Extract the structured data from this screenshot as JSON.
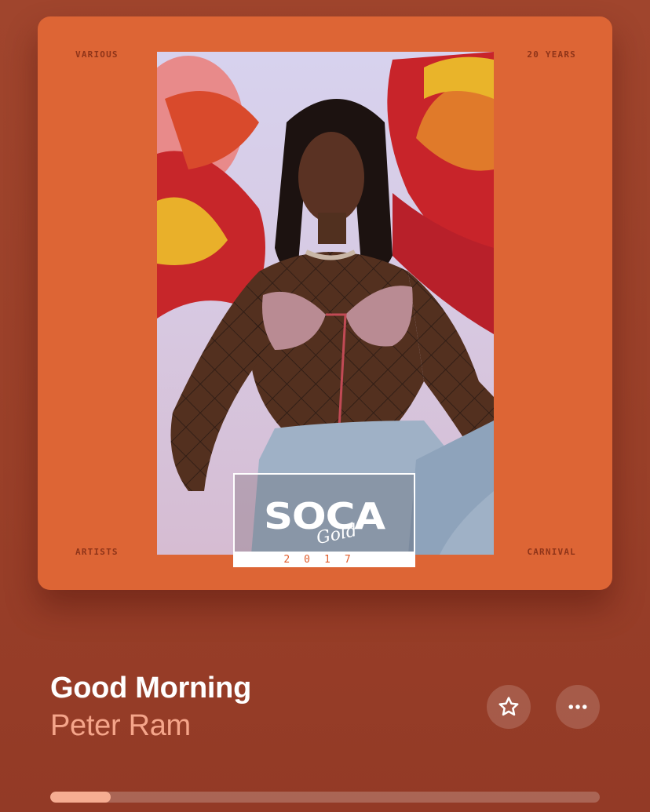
{
  "album_art": {
    "corner_top_left": "VARIOUS",
    "corner_top_right": "20 YEARS",
    "corner_bottom_left": "ARTISTS",
    "corner_bottom_right": "CARNIVAL",
    "logo_main": "SOCA",
    "logo_script": "Gold",
    "logo_year": "2017",
    "background_color": "#dd6535"
  },
  "track": {
    "title": "Good Morning",
    "artist": "Peter Ram"
  },
  "controls": {
    "favorite_icon": "star-icon",
    "more_icon": "ellipsis-icon"
  },
  "playback": {
    "progress_fraction": 0.11
  },
  "colors": {
    "background": "#9c422b",
    "artist_text": "#f5a58a",
    "progress_fill": "#f6ad92"
  }
}
